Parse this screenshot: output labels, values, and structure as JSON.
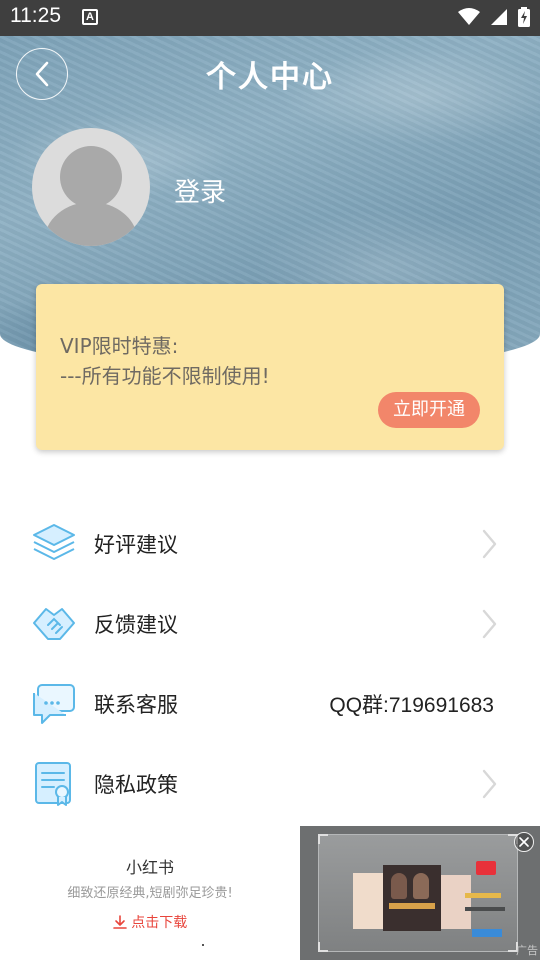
{
  "status_bar": {
    "time": "11:25",
    "notification_glyph": "A",
    "icons": [
      "wifi-icon",
      "signal-icon",
      "battery-charging-icon"
    ]
  },
  "header": {
    "title": "个人中心",
    "back_icon": "chevron-left-icon",
    "login_label": "登录"
  },
  "vip": {
    "line1": "VIP限时特惠:",
    "line2": "---所有功能不限制使用!",
    "button_label": "立即开通",
    "card_color": "#fce6a4",
    "button_color": "#f2866a"
  },
  "menu": {
    "items": [
      {
        "label": "好评建议",
        "icon": "layers-icon",
        "trailing": "chevron-right-icon"
      },
      {
        "label": "反馈建议",
        "icon": "handshake-icon",
        "trailing": "chevron-right-icon"
      },
      {
        "label": "联系客服",
        "icon": "chat-bubble-icon",
        "value": "QQ群:719691683"
      },
      {
        "label": "隐私政策",
        "icon": "certificate-icon",
        "trailing": "chevron-right-icon"
      }
    ]
  },
  "ad": {
    "app_name": "小红书",
    "description": "细致还原经典,短剧弥足珍贵!",
    "download_label": "点击下载",
    "tag": "广告"
  },
  "colors": {
    "accent_blue": "#5bb8e8",
    "header_blue": "#7ea3b9",
    "download_red": "#e8453c"
  }
}
